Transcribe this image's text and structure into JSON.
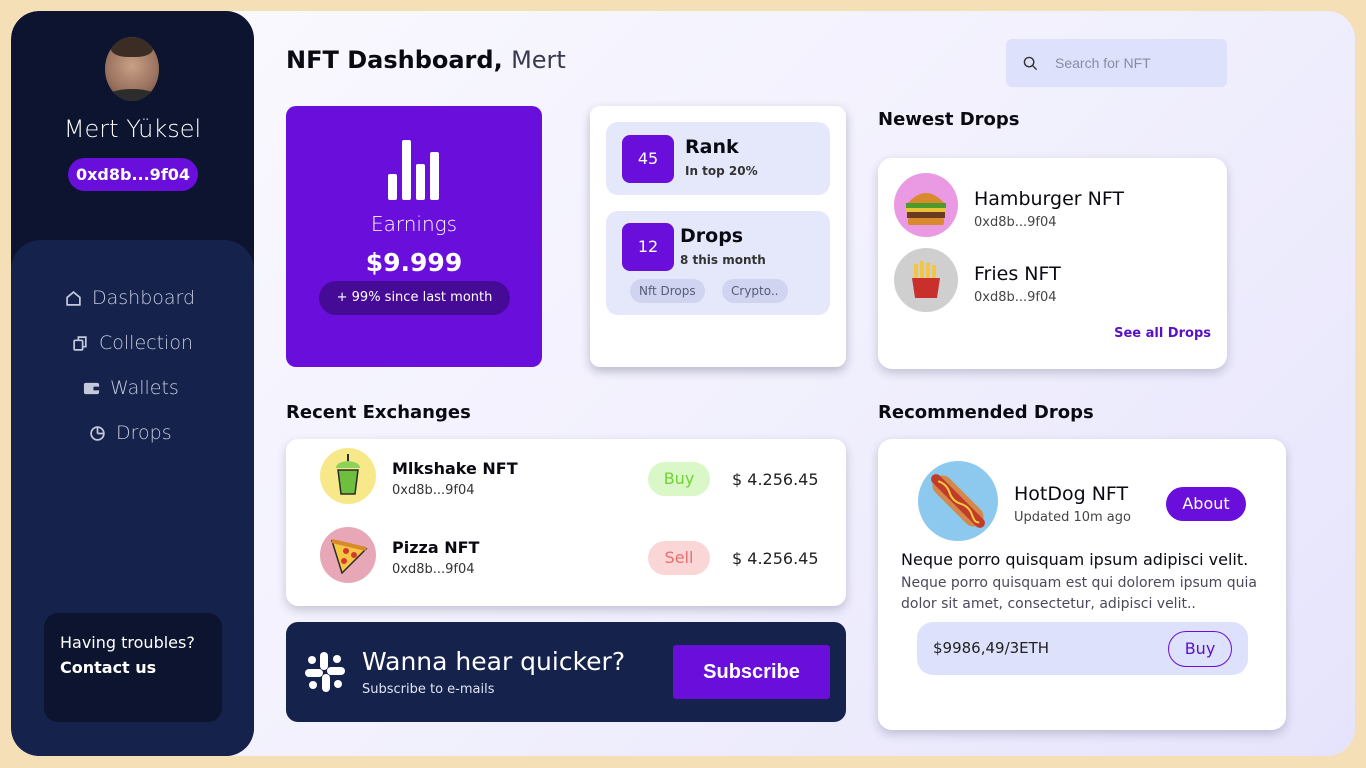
{
  "user": {
    "name": "Mert Yüksel",
    "wallet": "0xd8b...9f04"
  },
  "nav": [
    {
      "label": "Dashboard",
      "icon": "home-icon"
    },
    {
      "label": "Collection",
      "icon": "collection-icon"
    },
    {
      "label": "Wallets",
      "icon": "wallet-icon"
    },
    {
      "label": "Drops",
      "icon": "pie-chart-icon"
    }
  ],
  "help": {
    "line1": "Having troubles?",
    "line2": "Contact us"
  },
  "header": {
    "title": "NFT Dashboard,",
    "name": "Mert"
  },
  "search": {
    "placeholder": "Search for NFT"
  },
  "earnings": {
    "label": "Earnings",
    "value": "$9.999",
    "since": "+ 99% since last month"
  },
  "stats": {
    "rank": {
      "number": "45",
      "label": "Rank",
      "sub": "In top 20%"
    },
    "drops": {
      "number": "12",
      "label": "Drops",
      "sub": "8 this month",
      "tags": [
        "Nft Drops",
        "Crypto.."
      ]
    }
  },
  "newest": {
    "title": "Newest Drops",
    "items": [
      {
        "name": "Hamburger NFT",
        "addr": "0xd8b...9f04"
      },
      {
        "name": "Fries NFT",
        "addr": "0xd8b...9f04"
      }
    ],
    "see_all": "See all Drops"
  },
  "exchanges": {
    "title": "Recent Exchanges",
    "items": [
      {
        "name": "Mlkshake NFT",
        "addr": "0xd8b...9f04",
        "action": "Buy",
        "price": "$ 4.256.45"
      },
      {
        "name": "Pizza NFT",
        "addr": "0xd8b...9f04",
        "action": "Sell",
        "price": "$ 4.256.45"
      }
    ]
  },
  "subscribe": {
    "heading": "Wanna hear quicker?",
    "sub": "Subscribe to e-mails",
    "button": "Subscribe"
  },
  "recommended": {
    "title": "Recommended Drops",
    "name": "HotDog NFT",
    "updated": "Updated 10m ago",
    "about": "About",
    "heading": "Neque porro quisquam ipsum adipisci velit.",
    "description": "Neque porro quisquam est qui dolorem ipsum quia dolor sit amet, consectetur, adipisci velit..",
    "price": "$9986,49/3ETH",
    "buy": "Buy"
  },
  "colors": {
    "accent": "#6a0edb",
    "sidebar": "#0c1430",
    "nav": "#15234c",
    "buy": "#71d132",
    "sell": "#e86e6e"
  }
}
